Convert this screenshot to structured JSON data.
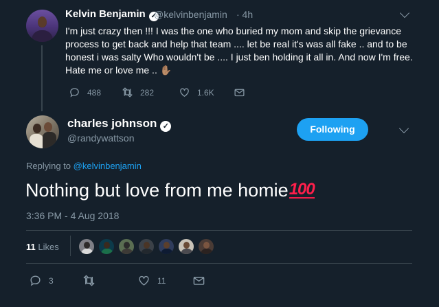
{
  "parent_tweet": {
    "author_name": "Kelvin Benjamin",
    "handle": "@kelvinbenjamin",
    "time": "· 4h",
    "text": "I'm just crazy then !!! I was the one who buried my mom and skip the grievance process to get back and help that team .... let be real it's was all  fake .. and to be honest i was salty Who wouldn't be .... I just ben holding it all in. And now I'm free. Hate me or love me .. ",
    "emoji": "✋🏽",
    "replies": "488",
    "retweets": "282",
    "likes": "1.6K"
  },
  "focal_tweet": {
    "author_name": "charles johnson",
    "handle": "@randywattson",
    "follow_label": "Following",
    "replying_prefix": "Replying to ",
    "replying_to": "@kelvinbenjamin",
    "text": "Nothing but love from me homie",
    "emoji_text": "100",
    "timestamp": "3:36 PM - 4 Aug 2018",
    "likes_count": "11",
    "likes_label": "Likes",
    "replies": "3",
    "retweets": "",
    "likes": "11"
  },
  "colors": {
    "background": "#15202b",
    "accent": "#1da1f2",
    "secondary_text": "#8899a6",
    "divider": "#38444d"
  },
  "liker_avatars": [
    {
      "bg": "#7f7f86",
      "head": "#2e2a2a",
      "body": "#d9d9d9"
    },
    {
      "bg": "#0c3a4a",
      "head": "#3a2a1e",
      "body": "#1b6f4a"
    },
    {
      "bg": "#5a6e52",
      "head": "#2b2b2b",
      "body": "#3d3a36"
    },
    {
      "bg": "#3b4148",
      "head": "#4a3526",
      "body": "#22282e"
    },
    {
      "bg": "#2f3c5c",
      "head": "#5b3f2c",
      "body": "#0e1b33"
    },
    {
      "bg": "#c9c3b8",
      "head": "#6a4b36",
      "body": "#4b4a4f"
    },
    {
      "bg": "#4a3b35",
      "head": "#7a5540",
      "body": "#2b2220"
    }
  ]
}
